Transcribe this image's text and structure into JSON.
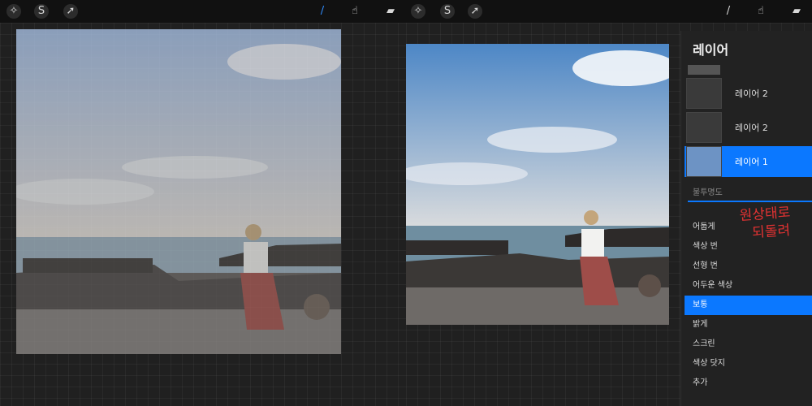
{
  "toolbar_left": {
    "tools": [
      "magic-wand-icon",
      "selection-icon",
      "transform-icon"
    ],
    "right_tools": [
      "brush-icon",
      "smudge-icon",
      "eraser-icon"
    ]
  },
  "toolbar_right": {
    "tools": [
      "magic-wand-icon",
      "selection-icon",
      "transform-icon"
    ],
    "right_tools": [
      "brush-icon",
      "smudge-icon",
      "eraser-icon"
    ]
  },
  "colors": {
    "accent": "#0b78ff",
    "panel": "#222222",
    "annotation": "#e23232"
  },
  "layers_panel": {
    "title": "레이어",
    "layers": [
      {
        "name": "레이어 2",
        "active": false
      },
      {
        "name": "레이어 2",
        "active": false
      },
      {
        "name": "레이어 1",
        "active": true
      }
    ],
    "opacity_label": "불투명도",
    "blend_modes": [
      "어둡게",
      "색상 번",
      "선형 번",
      "어두운 색상",
      "보통",
      "밝게",
      "스크린",
      "색상 닷지",
      "추가"
    ],
    "selected_blend": "보통"
  },
  "annotation": {
    "line1": "원상태로",
    "line2": "되돌려"
  }
}
